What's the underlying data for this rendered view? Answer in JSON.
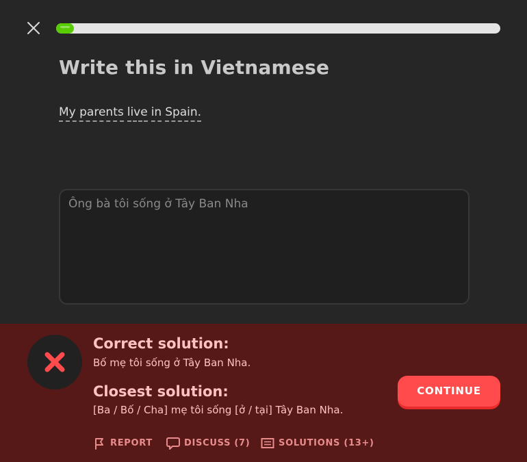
{
  "lesson": {
    "progress_percent": 4
  },
  "challenge": {
    "title": "Write this in Vietnamese",
    "prompt_words": [
      "My parents",
      "live",
      "in",
      "Spain."
    ],
    "answer_value": "Ông bà tôi sống ở Tây Ban Nha"
  },
  "feedback": {
    "correct_heading": "Correct solution:",
    "correct_text": "Bố mẹ tôi sống ở Tây Ban Nha.",
    "closest_heading": "Closest solution:",
    "closest_text": "[Ba / Bố / Cha] mẹ tôi sống [ở / tại] Tây Ban Nha.",
    "continue_label": "CONTINUE",
    "report_label": "REPORT",
    "discuss_label": "DISCUSS (7)",
    "solutions_label": "SOLUTIONS (13+)",
    "icons": [
      "close-icon",
      "x-mark-icon",
      "flag-icon",
      "speech-bubble-icon",
      "document-icon"
    ],
    "colors": {
      "background": "#262626",
      "panel": "#571818",
      "accent_red": "#ff4b4b",
      "progress_green": "#58cc02",
      "feedback_text": "#ffc1c1"
    }
  }
}
